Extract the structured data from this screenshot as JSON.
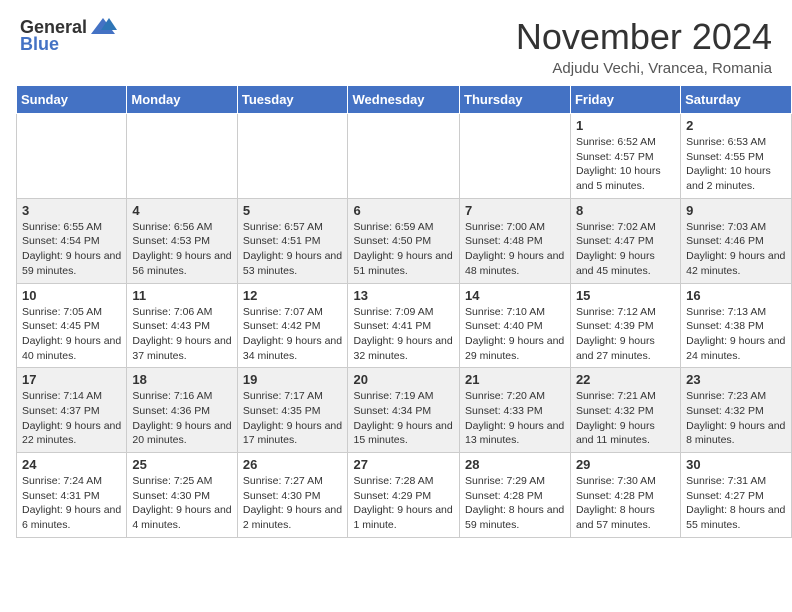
{
  "header": {
    "logo_general": "General",
    "logo_blue": "Blue",
    "month_title": "November 2024",
    "location": "Adjudu Vechi, Vrancea, Romania"
  },
  "weekdays": [
    "Sunday",
    "Monday",
    "Tuesday",
    "Wednesday",
    "Thursday",
    "Friday",
    "Saturday"
  ],
  "weeks": [
    [
      {
        "day": "",
        "info": ""
      },
      {
        "day": "",
        "info": ""
      },
      {
        "day": "",
        "info": ""
      },
      {
        "day": "",
        "info": ""
      },
      {
        "day": "",
        "info": ""
      },
      {
        "day": "1",
        "info": "Sunrise: 6:52 AM\nSunset: 4:57 PM\nDaylight: 10 hours and 5 minutes."
      },
      {
        "day": "2",
        "info": "Sunrise: 6:53 AM\nSunset: 4:55 PM\nDaylight: 10 hours and 2 minutes."
      }
    ],
    [
      {
        "day": "3",
        "info": "Sunrise: 6:55 AM\nSunset: 4:54 PM\nDaylight: 9 hours and 59 minutes."
      },
      {
        "day": "4",
        "info": "Sunrise: 6:56 AM\nSunset: 4:53 PM\nDaylight: 9 hours and 56 minutes."
      },
      {
        "day": "5",
        "info": "Sunrise: 6:57 AM\nSunset: 4:51 PM\nDaylight: 9 hours and 53 minutes."
      },
      {
        "day": "6",
        "info": "Sunrise: 6:59 AM\nSunset: 4:50 PM\nDaylight: 9 hours and 51 minutes."
      },
      {
        "day": "7",
        "info": "Sunrise: 7:00 AM\nSunset: 4:48 PM\nDaylight: 9 hours and 48 minutes."
      },
      {
        "day": "8",
        "info": "Sunrise: 7:02 AM\nSunset: 4:47 PM\nDaylight: 9 hours and 45 minutes."
      },
      {
        "day": "9",
        "info": "Sunrise: 7:03 AM\nSunset: 4:46 PM\nDaylight: 9 hours and 42 minutes."
      }
    ],
    [
      {
        "day": "10",
        "info": "Sunrise: 7:05 AM\nSunset: 4:45 PM\nDaylight: 9 hours and 40 minutes."
      },
      {
        "day": "11",
        "info": "Sunrise: 7:06 AM\nSunset: 4:43 PM\nDaylight: 9 hours and 37 minutes."
      },
      {
        "day": "12",
        "info": "Sunrise: 7:07 AM\nSunset: 4:42 PM\nDaylight: 9 hours and 34 minutes."
      },
      {
        "day": "13",
        "info": "Sunrise: 7:09 AM\nSunset: 4:41 PM\nDaylight: 9 hours and 32 minutes."
      },
      {
        "day": "14",
        "info": "Sunrise: 7:10 AM\nSunset: 4:40 PM\nDaylight: 9 hours and 29 minutes."
      },
      {
        "day": "15",
        "info": "Sunrise: 7:12 AM\nSunset: 4:39 PM\nDaylight: 9 hours and 27 minutes."
      },
      {
        "day": "16",
        "info": "Sunrise: 7:13 AM\nSunset: 4:38 PM\nDaylight: 9 hours and 24 minutes."
      }
    ],
    [
      {
        "day": "17",
        "info": "Sunrise: 7:14 AM\nSunset: 4:37 PM\nDaylight: 9 hours and 22 minutes."
      },
      {
        "day": "18",
        "info": "Sunrise: 7:16 AM\nSunset: 4:36 PM\nDaylight: 9 hours and 20 minutes."
      },
      {
        "day": "19",
        "info": "Sunrise: 7:17 AM\nSunset: 4:35 PM\nDaylight: 9 hours and 17 minutes."
      },
      {
        "day": "20",
        "info": "Sunrise: 7:19 AM\nSunset: 4:34 PM\nDaylight: 9 hours and 15 minutes."
      },
      {
        "day": "21",
        "info": "Sunrise: 7:20 AM\nSunset: 4:33 PM\nDaylight: 9 hours and 13 minutes."
      },
      {
        "day": "22",
        "info": "Sunrise: 7:21 AM\nSunset: 4:32 PM\nDaylight: 9 hours and 11 minutes."
      },
      {
        "day": "23",
        "info": "Sunrise: 7:23 AM\nSunset: 4:32 PM\nDaylight: 9 hours and 8 minutes."
      }
    ],
    [
      {
        "day": "24",
        "info": "Sunrise: 7:24 AM\nSunset: 4:31 PM\nDaylight: 9 hours and 6 minutes."
      },
      {
        "day": "25",
        "info": "Sunrise: 7:25 AM\nSunset: 4:30 PM\nDaylight: 9 hours and 4 minutes."
      },
      {
        "day": "26",
        "info": "Sunrise: 7:27 AM\nSunset: 4:30 PM\nDaylight: 9 hours and 2 minutes."
      },
      {
        "day": "27",
        "info": "Sunrise: 7:28 AM\nSunset: 4:29 PM\nDaylight: 9 hours and 1 minute."
      },
      {
        "day": "28",
        "info": "Sunrise: 7:29 AM\nSunset: 4:28 PM\nDaylight: 8 hours and 59 minutes."
      },
      {
        "day": "29",
        "info": "Sunrise: 7:30 AM\nSunset: 4:28 PM\nDaylight: 8 hours and 57 minutes."
      },
      {
        "day": "30",
        "info": "Sunrise: 7:31 AM\nSunset: 4:27 PM\nDaylight: 8 hours and 55 minutes."
      }
    ]
  ]
}
